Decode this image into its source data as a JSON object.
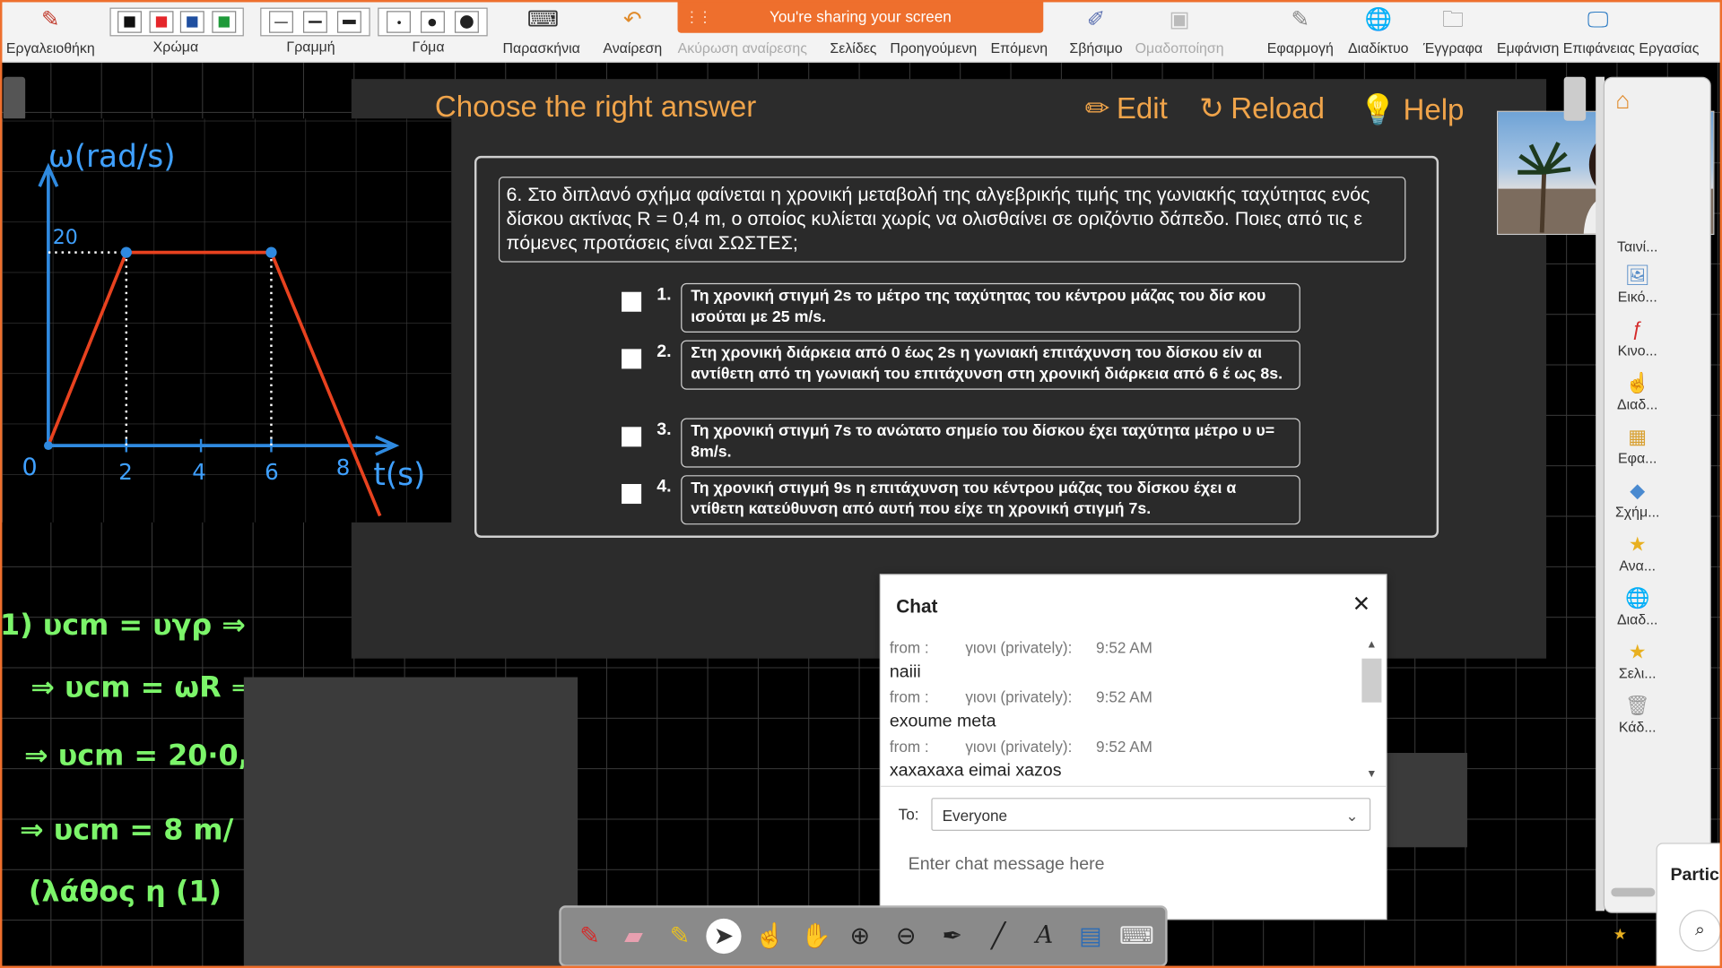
{
  "toolbar": {
    "toolbox": "Εργαλειοθήκη",
    "color": "Χρώμα",
    "line": "Γραμμή",
    "fill": "Γόμα",
    "background": "Παρασκήνια",
    "undo": "Αναίρεση",
    "redo": "Ακύρωση αναίρεσης",
    "pages": "Σελίδες",
    "previous": "Προηγούμενη",
    "next": "Επόμενη",
    "eraser": "Σβήσιμο",
    "group": "Ομαδοποίηση",
    "app": "Εφαρμογή",
    "internet": "Διαδίκτυο",
    "documents": "Έγγραφα",
    "show_desktop": "Εμφάνιση Επιφάνειας Εργασίας",
    "share_banner": "You're sharing your screen",
    "swatch_colors": [
      "#111111",
      "#e5262b",
      "#1f4fa0",
      "#1f9a3a"
    ]
  },
  "quiz": {
    "title": "Choose the right answer",
    "edit": "Edit",
    "reload": "Reload",
    "help": "Help",
    "question": "6. Στο διπλανό σχήμα φαίνεται η χρονική μεταβολή της αλγεβρικής τιμής της γωνιακής ταχύτητας ενός δίσκου ακτίνας R = 0,4 m, ο οποίος κυλίεται χωρίς να ολισθαίνει σε οριζόντιο δάπεδο. Ποιες από τις ε πόμενες προτάσεις είναι ΣΩΣΤΕΣ;",
    "options": [
      {
        "num": "1.",
        "text": "Τη χρονική στιγμή 2s το μέτρο της ταχύτητας του κέντρου μάζας του δίσ κου ισούται με 25 m/s."
      },
      {
        "num": "2.",
        "text": "Στη χρονική διάρκεια από 0 έως 2s η γωνιακή επιτάχυνση του δίσκου είν αι αντίθετη από τη γωνιακή του επιτάχυνση στη χρονική διάρκεια από 6 έ ως 8s."
      },
      {
        "num": "3.",
        "text": "Τη χρονική στιγμή 7s το ανώτατο σημείο του δίσκου έχει ταχύτητα μέτρο υ υ= 8m/s."
      },
      {
        "num": "4.",
        "text": "Τη χρονική στιγμή 9s η επιτάχυνση του κέντρου μάζας του δίσκου έχει α ντίθετη κατεύθυνση από αυτή που είχε τη χρονική στιγμή 7s."
      }
    ]
  },
  "graph": {
    "ylabel": "ω(rad/s)",
    "xlabel": "t(s)",
    "y_tick": "20",
    "x_ticks": [
      "0",
      "2",
      "4",
      "6",
      "8"
    ]
  },
  "handwriting": [
    "1) υcm = υγρ ⇒",
    "⇒ υcm = ωR ⇒",
    "⇒ υcm = 20·0,",
    "⇒ υcm = 8 m/",
    "(λάθος η (1)"
  ],
  "chat": {
    "title": "Chat",
    "messages": [
      {
        "from": "from :",
        "who": "γιονι (privately):",
        "time": "9:52 AM",
        "text": "naiii"
      },
      {
        "from": "from :",
        "who": "γιονι (privately):",
        "time": "9:52 AM",
        "text": "exoume meta"
      },
      {
        "from": "from :",
        "who": "γιονι (privately):",
        "time": "9:52 AM",
        "text": "xaxaxaxa eimai xazos"
      }
    ],
    "to_label": "To:",
    "to_value": "Everyone",
    "input_placeholder": "Enter chat message here"
  },
  "sidebar": {
    "items": [
      "Ταινί...",
      "Εικό...",
      "Κινο...",
      "Διαδ...",
      "Εφα...",
      "Σχήμ...",
      "Ανα...",
      "Διαδ...",
      "Σελι...",
      "Κάδ..."
    ]
  },
  "participants": {
    "label": "Partic"
  }
}
